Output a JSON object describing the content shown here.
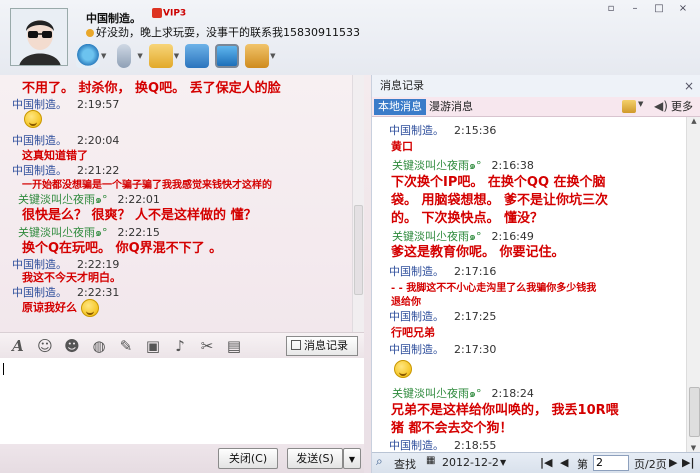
{
  "header": {
    "nickname": "中国制造。",
    "vip_badge": "VIP3",
    "signature": "好没劲，晚上求玩耍，没事干的联系我15830911533",
    "window_controls": [
      "▫",
      "–",
      "□",
      "×"
    ]
  },
  "toolbar": {
    "items": [
      "video-call",
      "voice-call",
      "send-file",
      "create-discussion",
      "remote-assist",
      "app-menu"
    ]
  },
  "chat": {
    "messages": [
      {
        "kind": "text",
        "style": "big",
        "text": "不用了。 封杀你， 换Q吧。 丢了保定人的脸"
      },
      {
        "kind": "header",
        "user": "中国制造。",
        "time": "2:19:57",
        "color": "blue"
      },
      {
        "kind": "emoji"
      },
      {
        "kind": "header",
        "user": "中国制造。",
        "time": "2:20:04",
        "color": "blue"
      },
      {
        "kind": "text",
        "style": "mid",
        "text": "这真知道错了"
      },
      {
        "kind": "header",
        "user": "中国制造。",
        "time": "2:21:22",
        "color": "blue"
      },
      {
        "kind": "text",
        "style": "mid",
        "text": "一开始都没想骗是一个骗子骗了我我感觉来钱快才这样的"
      },
      {
        "kind": "header",
        "user": "关键淡叫尐夜雨๑°",
        "time": "2:22:01",
        "color": "green"
      },
      {
        "kind": "text",
        "style": "big",
        "text": "很快是么？ 很爽？ 人不是这样做的 懂？"
      },
      {
        "kind": "header",
        "user": "关键淡叫尐夜雨๑°",
        "time": "2:22:15",
        "color": "green"
      },
      {
        "kind": "text",
        "style": "big",
        "text": "换个Q在玩吧。 你Q界混不下了 。"
      },
      {
        "kind": "header",
        "user": "中国制造。",
        "time": "2:22:19",
        "color": "blue"
      },
      {
        "kind": "text",
        "style": "mid",
        "text": "我这不今天才明白。"
      },
      {
        "kind": "header",
        "user": "中国制造。",
        "time": "2:22:31",
        "color": "blue"
      },
      {
        "kind": "text",
        "style": "mid",
        "text": "原谅我好么",
        "emoji": true
      }
    ]
  },
  "input_toolbar": {
    "message_record_label": "消息记录"
  },
  "bottom": {
    "close_label": "关闭(C)",
    "send_label": "发送(S)"
  },
  "history": {
    "title": "消息记录",
    "tab_local": "本地消息",
    "tab_roam": "漫游消息",
    "more": "更多",
    "entries": [
      {
        "kind": "header",
        "user": "中国制造。",
        "time": "2:15:36",
        "color": "blue"
      },
      {
        "kind": "text",
        "style": "mid",
        "text": "黄口"
      },
      {
        "kind": "header",
        "user": "关键淡叫尐夜雨๑°",
        "time": "2:16:38",
        "color": "green"
      },
      {
        "kind": "text",
        "style": "big",
        "text": "下次换个IP吧。 在换个QQ 在换个脑"
      },
      {
        "kind": "text",
        "style": "big",
        "text": "袋。 用脑袋想想。 爹不是让你坑三次"
      },
      {
        "kind": "text",
        "style": "big",
        "text": "的。 下次换快点。 懂没？"
      },
      {
        "kind": "header",
        "user": "关键淡叫尐夜雨๑°",
        "time": "2:16:49",
        "color": "green"
      },
      {
        "kind": "text",
        "style": "big",
        "text": "爹这是教育你呢。 你要记住。"
      },
      {
        "kind": "header",
        "user": "中国制造。",
        "time": "2:17:16",
        "color": "blue"
      },
      {
        "kind": "text",
        "style": "mid",
        "text": "- - 我脚这不不小心走沟里了么我骗你多少钱我"
      },
      {
        "kind": "text",
        "style": "mid",
        "text": "退给你"
      },
      {
        "kind": "header",
        "user": "中国制造。",
        "time": "2:17:25",
        "color": "blue"
      },
      {
        "kind": "text",
        "style": "mid",
        "text": "行吧兄弟"
      },
      {
        "kind": "header",
        "user": "中国制造。",
        "time": "2:17:30",
        "color": "blue"
      },
      {
        "kind": "emoji"
      },
      {
        "kind": "header",
        "user": "关键淡叫尐夜雨๑°",
        "time": "2:18:24",
        "color": "green"
      },
      {
        "kind": "text",
        "style": "big",
        "text": "兄弟不是这样给你叫唤的， 我丢10R喂"
      },
      {
        "kind": "text",
        "style": "big",
        "text": "猪 都不会去交个狗！"
      },
      {
        "kind": "header",
        "user": "中国制造。",
        "time": "2:18:55",
        "color": "blue"
      }
    ],
    "footer": {
      "search": "查找",
      "date": "2012-12-2",
      "page_prefix": "第",
      "page_value": "2",
      "page_suffix": "页/2页"
    }
  }
}
